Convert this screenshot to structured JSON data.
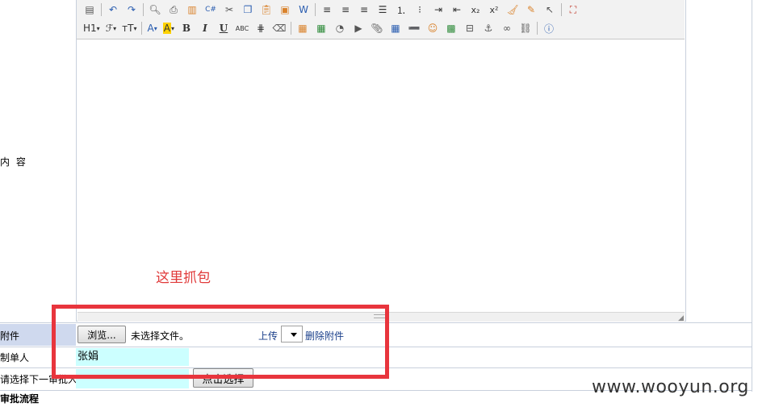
{
  "left_labels": {
    "content": "内 容",
    "attachment": "附件",
    "creator": "制单人",
    "next_approver": "请选择下一审批人",
    "flow": "审批流程"
  },
  "toolbar": {
    "row1": [
      "source-icon",
      "undo-icon",
      "redo-icon",
      "preview-icon",
      "print-icon",
      "template-icon",
      "code-icon",
      "cut-icon",
      "copy-icon",
      "paste-icon",
      "paste-text-icon",
      "paste-word-icon",
      "align-left-icon",
      "align-center-icon",
      "align-right-icon",
      "justify-icon",
      "ordered-list-icon",
      "unordered-list-icon",
      "indent-icon",
      "outdent-icon",
      "subscript-icon",
      "superscript-icon",
      "clear-format-icon",
      "select-all-icon",
      "pointer-icon",
      "fullscreen-icon"
    ],
    "heading_label": "H1",
    "font_label": "ℱ",
    "size_label": "тT",
    "font_color_label": "A",
    "highlight_label": "A",
    "bold_label": "B",
    "italic_label": "I",
    "underline_label": "U",
    "strike_label": "ABC"
  },
  "editor": {
    "annotation": "这里抓包"
  },
  "attachment": {
    "browse_label": "浏览...",
    "no_file_text": "未选择文件。",
    "upload_label": "上传",
    "delete_label": "删除附件"
  },
  "creator": {
    "value": "张娟"
  },
  "next_approver": {
    "button_label": "点击选择"
  },
  "watermark": "www.wooyun.org",
  "colors": {
    "annotation": "#e03a3a",
    "highlight_box": "#e8353d",
    "input_bg": "#ccffff",
    "label_bg": "#cfd9ee"
  }
}
